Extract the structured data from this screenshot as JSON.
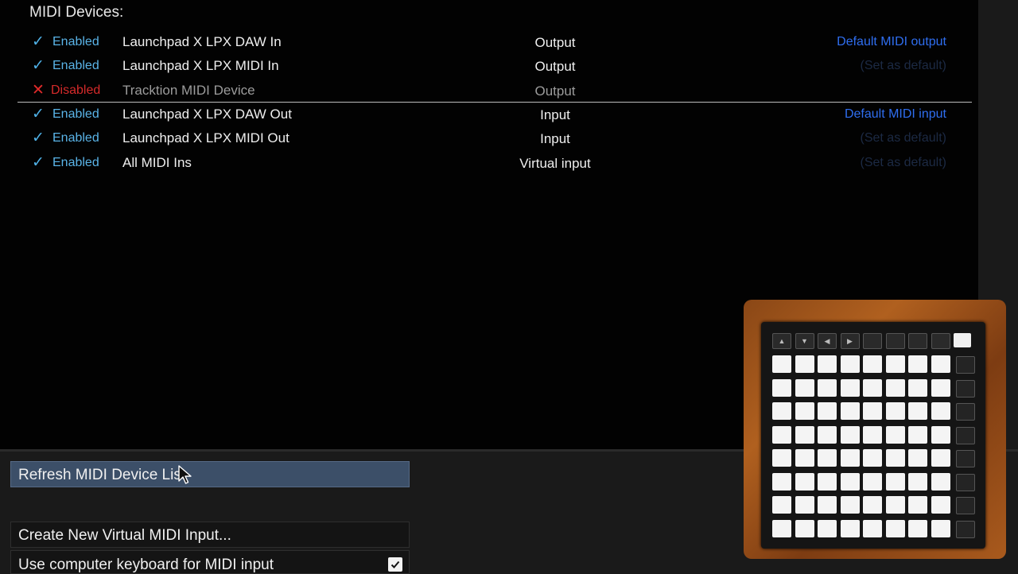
{
  "header": {
    "title": "MIDI Devices:"
  },
  "devices": [
    {
      "enabled": true,
      "mark": "✓",
      "status": "Enabled",
      "name": "Launchpad X LPX DAW In",
      "type": "Output",
      "default": "Default MIDI output"
    },
    {
      "enabled": true,
      "mark": "✓",
      "status": "Enabled",
      "name": "Launchpad X LPX MIDI In",
      "type": "Output",
      "default": "(Set as default)"
    },
    {
      "enabled": false,
      "mark": "✕",
      "status": "Disabled",
      "name": "Tracktion MIDI Device",
      "type": "Output",
      "default": ""
    },
    {
      "enabled": true,
      "mark": "✓",
      "status": "Enabled",
      "name": "Launchpad X LPX DAW Out",
      "type": "Input",
      "default": "Default MIDI input"
    },
    {
      "enabled": true,
      "mark": "✓",
      "status": "Enabled",
      "name": "Launchpad X LPX MIDI Out",
      "type": "Input",
      "default": "(Set as default)"
    },
    {
      "enabled": true,
      "mark": "✓",
      "status": "Enabled",
      "name": "All MIDI Ins",
      "type": "Virtual input",
      "default": "(Set as default)"
    }
  ],
  "buttons": {
    "refresh": "Refresh MIDI Device List",
    "create_virtual": "Create New Virtual MIDI Input...",
    "computer_keyboard": "Use computer keyboard for MIDI input"
  },
  "computer_keyboard_checked": true,
  "colors": {
    "enabled": "#5ab4e8",
    "disabled": "#d52a2a",
    "default_link": "#2f6ef0",
    "button_highlight": "#3c4f68"
  },
  "photo": {
    "subject": "launchpad-controller-photo"
  }
}
